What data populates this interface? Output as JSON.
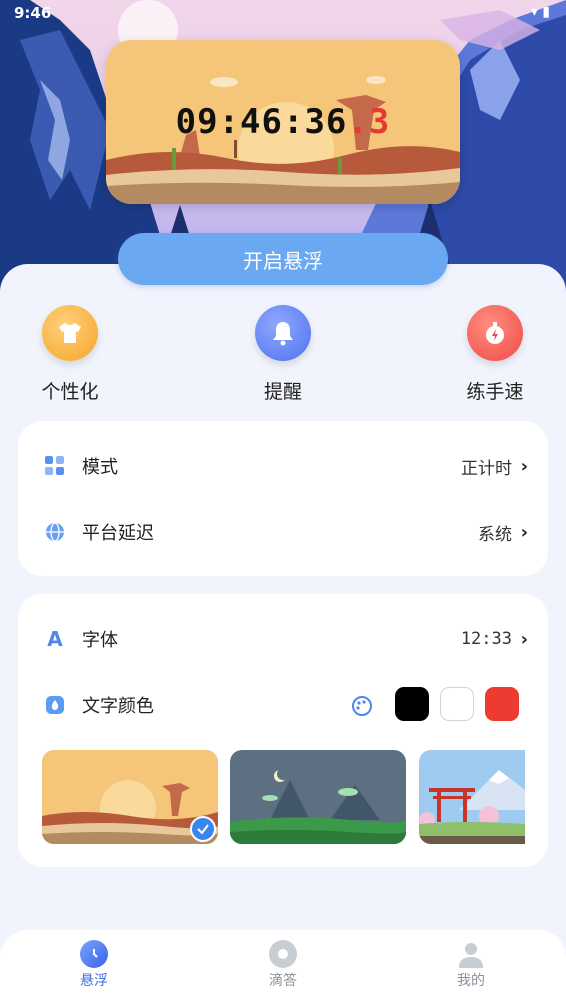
{
  "status_bar": {
    "time": "9:46"
  },
  "preview": {
    "clock_main": "09:46:36",
    "clock_ms": ".3"
  },
  "float_button": {
    "label": "开启悬浮"
  },
  "features": [
    {
      "label": "个性化",
      "icon": "shirt-icon",
      "color": "#f7b23b"
    },
    {
      "label": "提醒",
      "icon": "bell-icon",
      "color": "#5b7ff2"
    },
    {
      "label": "练手速",
      "icon": "stopwatch-icon",
      "color": "#f25a55"
    }
  ],
  "settings_card1": {
    "mode_label": "模式",
    "mode_value": "正计时",
    "delay_label": "平台延迟",
    "delay_value": "系统"
  },
  "settings_card2": {
    "font_label": "字体",
    "font_value": "12:33",
    "color_label": "文字颜色",
    "swatches": [
      "#000000",
      "#ffffff",
      "#ee3b32"
    ]
  },
  "themes": [
    {
      "name": "desert",
      "selected": true
    },
    {
      "name": "night-forest",
      "selected": false
    },
    {
      "name": "torii-mountain",
      "selected": false
    }
  ],
  "bottom_nav": {
    "items": [
      {
        "label": "悬浮",
        "active": true
      },
      {
        "label": "滴答",
        "active": false
      },
      {
        "label": "我的",
        "active": false
      }
    ],
    "active_color": "#3a6fe0"
  }
}
